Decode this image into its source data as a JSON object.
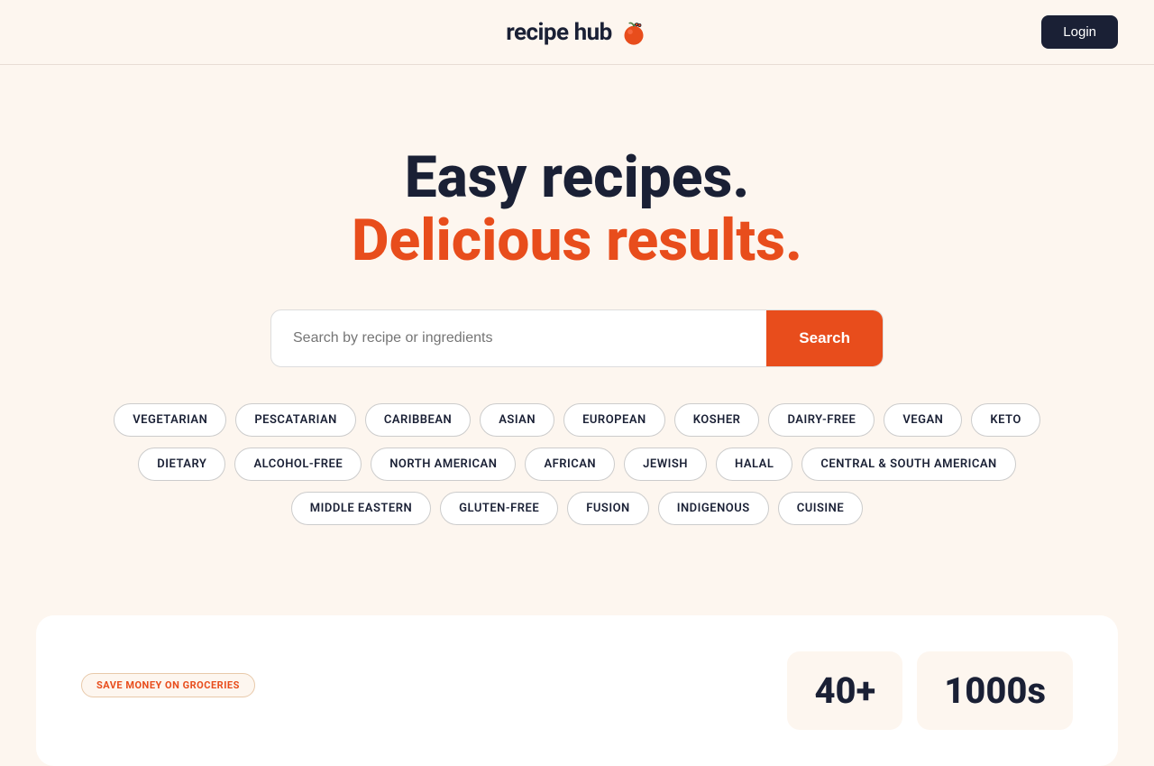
{
  "header": {
    "logo_text": "recipe hub",
    "login_label": "Login"
  },
  "hero": {
    "title_line1": "Easy recipes.",
    "title_line2": "Delicious results."
  },
  "search": {
    "placeholder": "Search by recipe or ingredients",
    "button_label": "Search"
  },
  "tags": {
    "row1": [
      "VEGETARIAN",
      "PESCATARIAN",
      "CARIBBEAN",
      "ASIAN",
      "EUROPEAN",
      "KOSHER",
      "DAIRY-FREE",
      "VEGAN",
      "KETO"
    ],
    "row2": [
      "DIETARY",
      "ALCOHOL-FREE",
      "NORTH AMERICAN",
      "AFRICAN",
      "JEWISH",
      "HALAL",
      "CENTRAL & SOUTH AMERICAN"
    ],
    "row3": [
      "MIDDLE EASTERN",
      "GLUTEN-FREE",
      "FUSION",
      "INDIGENOUS",
      "CUISINE"
    ]
  },
  "bottom_card": {
    "badge_label": "SAVE MONEY ON GROCERIES",
    "stat1_number": "40+",
    "stat2_number": "1000s"
  },
  "colors": {
    "accent": "#e84d1c",
    "dark": "#1a2035",
    "bg": "#fdf6ef"
  }
}
